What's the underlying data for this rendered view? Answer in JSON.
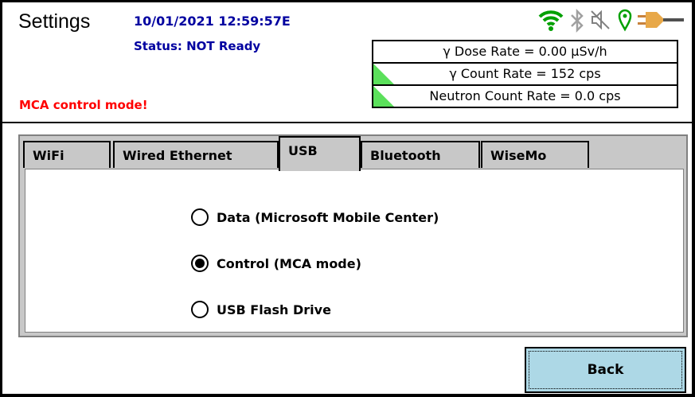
{
  "header": {
    "title": "Settings",
    "datetime": "10/01/2021 12:59:57E",
    "status": "Status: NOT Ready",
    "mode_warning": "MCA control mode!"
  },
  "icons": [
    "wifi-icon",
    "bluetooth-icon",
    "speaker-muted-icon",
    "location-pin-icon",
    "power-plug-icon"
  ],
  "readings": [
    {
      "label": "γ Dose Rate = 0.00  µSv/h",
      "indicator": false
    },
    {
      "label": "γ Count Rate = 152 cps",
      "indicator": true
    },
    {
      "label": "Neutron Count Rate = 0.0 cps",
      "indicator": true
    }
  ],
  "tabs": [
    {
      "label": "WiFi",
      "active": false
    },
    {
      "label": "Wired Ethernet",
      "active": false
    },
    {
      "label": "USB",
      "active": true
    },
    {
      "label": "Bluetooth",
      "active": false
    },
    {
      "label": "WiseMo",
      "active": false
    }
  ],
  "usb_options": [
    {
      "label": "Data (Microsoft Mobile Center)",
      "selected": false
    },
    {
      "label": "Control (MCA mode)",
      "selected": true
    },
    {
      "label": "USB Flash Drive",
      "selected": false
    }
  ],
  "footer": {
    "back_label": "Back"
  },
  "colors": {
    "status_text": "#0000a0",
    "warning": "#ff0000",
    "indicator": "#5be05b",
    "button": "#add8e6",
    "wifi": "#00a000",
    "location": "#00a000",
    "plug": "#c8823c"
  }
}
